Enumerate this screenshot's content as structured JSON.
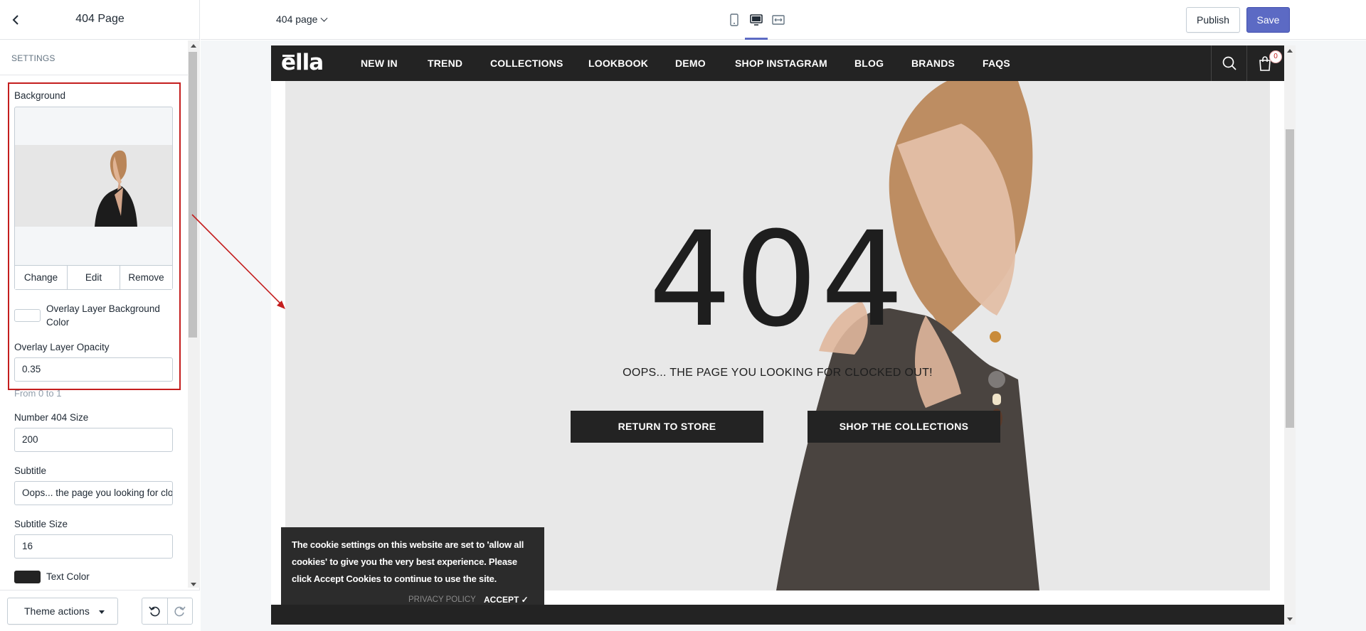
{
  "sidebar": {
    "title": "404 Page",
    "settings_heading": "SETTINGS",
    "background_label": "Background",
    "background_buttons": {
      "change": "Change",
      "edit": "Edit",
      "remove": "Remove"
    },
    "overlay_color_label": "Overlay Layer Background Color",
    "overlay_color_value": "#ffffff",
    "overlay_opacity_label": "Overlay Layer Opacity",
    "overlay_opacity_value": "0.35",
    "overlay_opacity_help": "From 0 to 1",
    "number_size_label": "Number 404 Size",
    "number_size_value": "200",
    "subtitle_label": "Subtitle",
    "subtitle_value": "Oops... the page you looking for clocked out!",
    "subtitle_size_label": "Subtitle Size",
    "subtitle_size_value": "16",
    "text_color_label": "Text Color",
    "text_color_value": "#232323",
    "theme_actions_label": "Theme actions"
  },
  "topbar": {
    "page_select_label": "404 page",
    "devices": [
      "mobile-icon",
      "desktop-icon",
      "fullscreen-icon"
    ],
    "active_device": "desktop",
    "publish_label": "Publish",
    "save_label": "Save"
  },
  "store": {
    "logo": "ella",
    "nav": [
      "NEW IN",
      "TREND",
      "COLLECTIONS",
      "LOOKBOOK",
      "DEMO",
      "SHOP INSTAGRAM",
      "BLOG",
      "BRANDS",
      "FAQS"
    ],
    "cart_count": "0",
    "error_code": "404",
    "error_subtitle": "OOPS... THE PAGE YOU LOOKING FOR CLOCKED OUT!",
    "buttons": {
      "return": "RETURN TO STORE",
      "shop": "SHOP THE COLLECTIONS"
    },
    "cookie": {
      "text": "The cookie settings on this website are set to 'allow all cookies' to give you the very best experience. Please click Accept Cookies to continue to use the site.",
      "policy_label": "PRIVACY POLICY",
      "accept_label": "ACCEPT ✓"
    }
  },
  "colors": {
    "accent": "#5c6ac4",
    "highlight": "#c41e1e",
    "store_dark": "#232323"
  }
}
